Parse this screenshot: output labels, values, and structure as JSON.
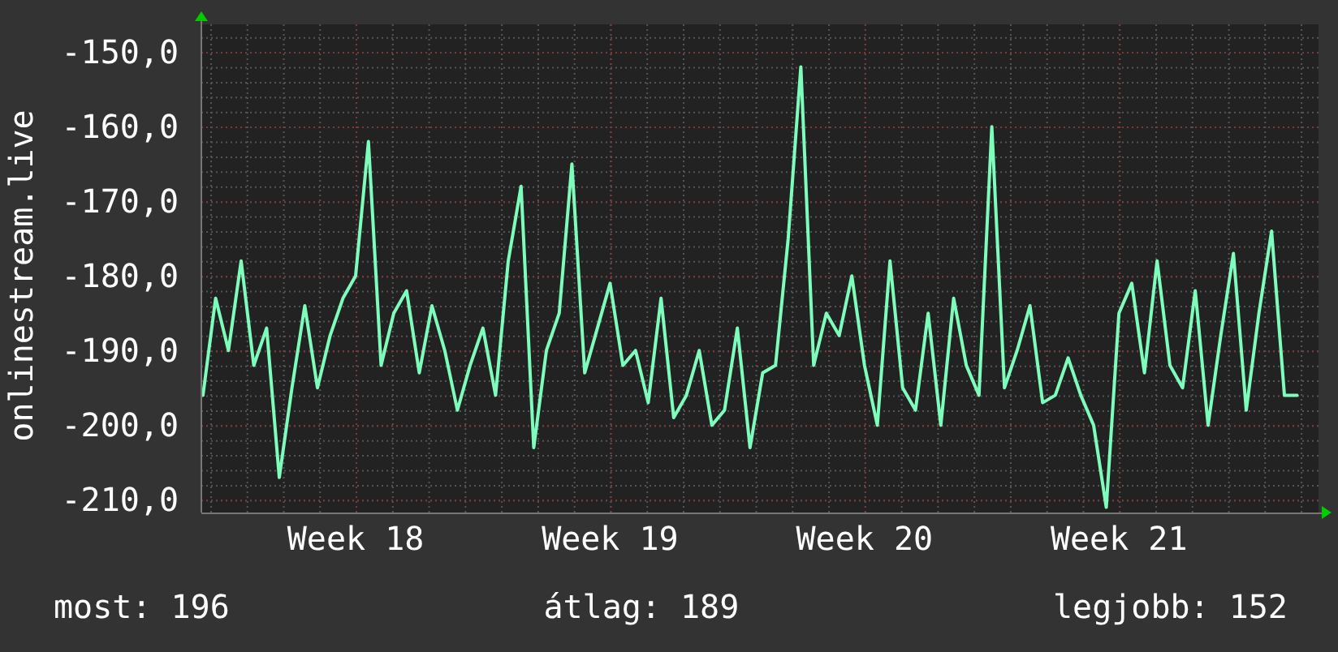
{
  "graph": {
    "chart_data": {
      "type": "line",
      "grid": true,
      "ylabel": "onlinestream.live",
      "ylim": [
        -211.7,
        -146.3
      ],
      "yticks": [
        {
          "value": -150,
          "label": "-150,0"
        },
        {
          "value": -160,
          "label": "-160,0"
        },
        {
          "value": -170,
          "label": "-170,0"
        },
        {
          "value": -180,
          "label": "-180,0"
        },
        {
          "value": -190,
          "label": "-190,0"
        },
        {
          "value": -200,
          "label": "-200,0"
        },
        {
          "value": -210,
          "label": "-210,0"
        }
      ],
      "categories": [
        null,
        null,
        null,
        null,
        null,
        null,
        null,
        null,
        null,
        null,
        null,
        null,
        "Week 18",
        null,
        null,
        null,
        null,
        null,
        null,
        null,
        null,
        null,
        null,
        null,
        null,
        null,
        null,
        null,
        null,
        null,
        null,
        null,
        "Week 19",
        null,
        null,
        null,
        null,
        null,
        null,
        null,
        null,
        null,
        null,
        null,
        null,
        null,
        null,
        null,
        null,
        null,
        null,
        null,
        "Week 20",
        null,
        null,
        null,
        null,
        null,
        null,
        null,
        null,
        null,
        null,
        null,
        null,
        null,
        null,
        null,
        null,
        null,
        null,
        null,
        "Week 21",
        null,
        null,
        null,
        null,
        null,
        null,
        null,
        null,
        null,
        null,
        null,
        null,
        null,
        null
      ],
      "series": [
        {
          "color": "#7dfcbc",
          "values": [
            -196,
            -183,
            -190,
            -178,
            -192,
            -187,
            -207,
            -195,
            -184,
            -195,
            -188,
            -183,
            -180,
            -162,
            -192,
            -185,
            -182,
            -193,
            -184,
            -190,
            -198,
            -192,
            -187,
            -196,
            -178,
            -168,
            -203,
            -190,
            -185,
            -165,
            -193,
            -187,
            -181,
            -192,
            -190,
            -197,
            -183,
            -199,
            -196,
            -190,
            -200,
            -198,
            -187,
            -203,
            -193,
            -192,
            -175,
            -152,
            -192,
            -185,
            -188,
            -180,
            -192,
            -200,
            -178,
            -195,
            -198,
            -185,
            -200,
            -183,
            -192,
            -196,
            -160,
            -195,
            -190,
            -184,
            -197,
            -196,
            -191,
            -196,
            -200,
            -211,
            -185,
            -181,
            -193,
            -178,
            -192,
            -195,
            -182,
            -200,
            -188,
            -177,
            -198,
            -185,
            -174,
            -196,
            -196
          ]
        }
      ]
    }
  },
  "summary": [
    {
      "label": "most: 196"
    },
    {
      "label": "átlag: 189"
    },
    {
      "label": "legjobb: 152"
    }
  ]
}
